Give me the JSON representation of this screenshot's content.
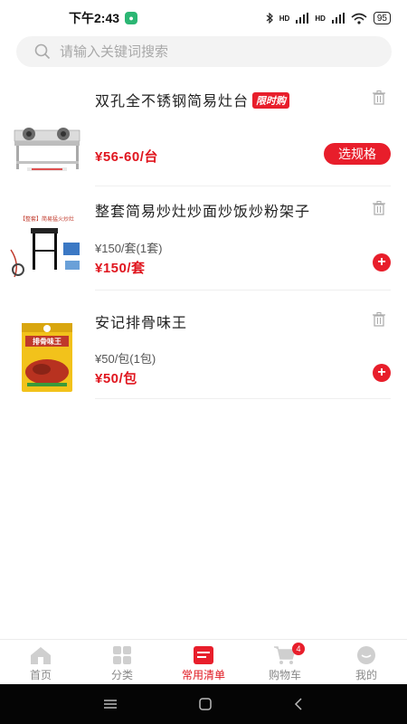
{
  "status": {
    "time": "下午2:43",
    "signal_label_1": "HD",
    "signal_label_2": "HD",
    "battery": "95"
  },
  "search": {
    "placeholder": "请输入关键词搜索"
  },
  "items": [
    {
      "title": "双孔全不锈钢简易灶台",
      "tag": "限时购",
      "unit_price": "",
      "price": "¥56-60/台",
      "action": "选规格"
    },
    {
      "title": "整套简易炒灶炒面炒饭炒粉架子",
      "thumb_caption": "【整套】简易猛火炒灶",
      "unit_price": "¥150/套(1套)",
      "price": "¥150/套",
      "action": "+"
    },
    {
      "title": "安记排骨味王",
      "thumb_caption": "排骨味王",
      "unit_price": "¥50/包(1包)",
      "price": "¥50/包",
      "action": "+"
    }
  ],
  "tabs": [
    {
      "label": "首页",
      "icon": "home-icon",
      "active": false
    },
    {
      "label": "分类",
      "icon": "category-icon",
      "active": false
    },
    {
      "label": "常用清单",
      "icon": "list-icon",
      "active": true
    },
    {
      "label": "购物车",
      "icon": "cart-icon",
      "active": false,
      "badge": "4"
    },
    {
      "label": "我的",
      "icon": "profile-icon",
      "active": false
    }
  ],
  "colors": {
    "accent": "#e81e2b",
    "price": "#e0161f",
    "inactive": "#888888"
  }
}
